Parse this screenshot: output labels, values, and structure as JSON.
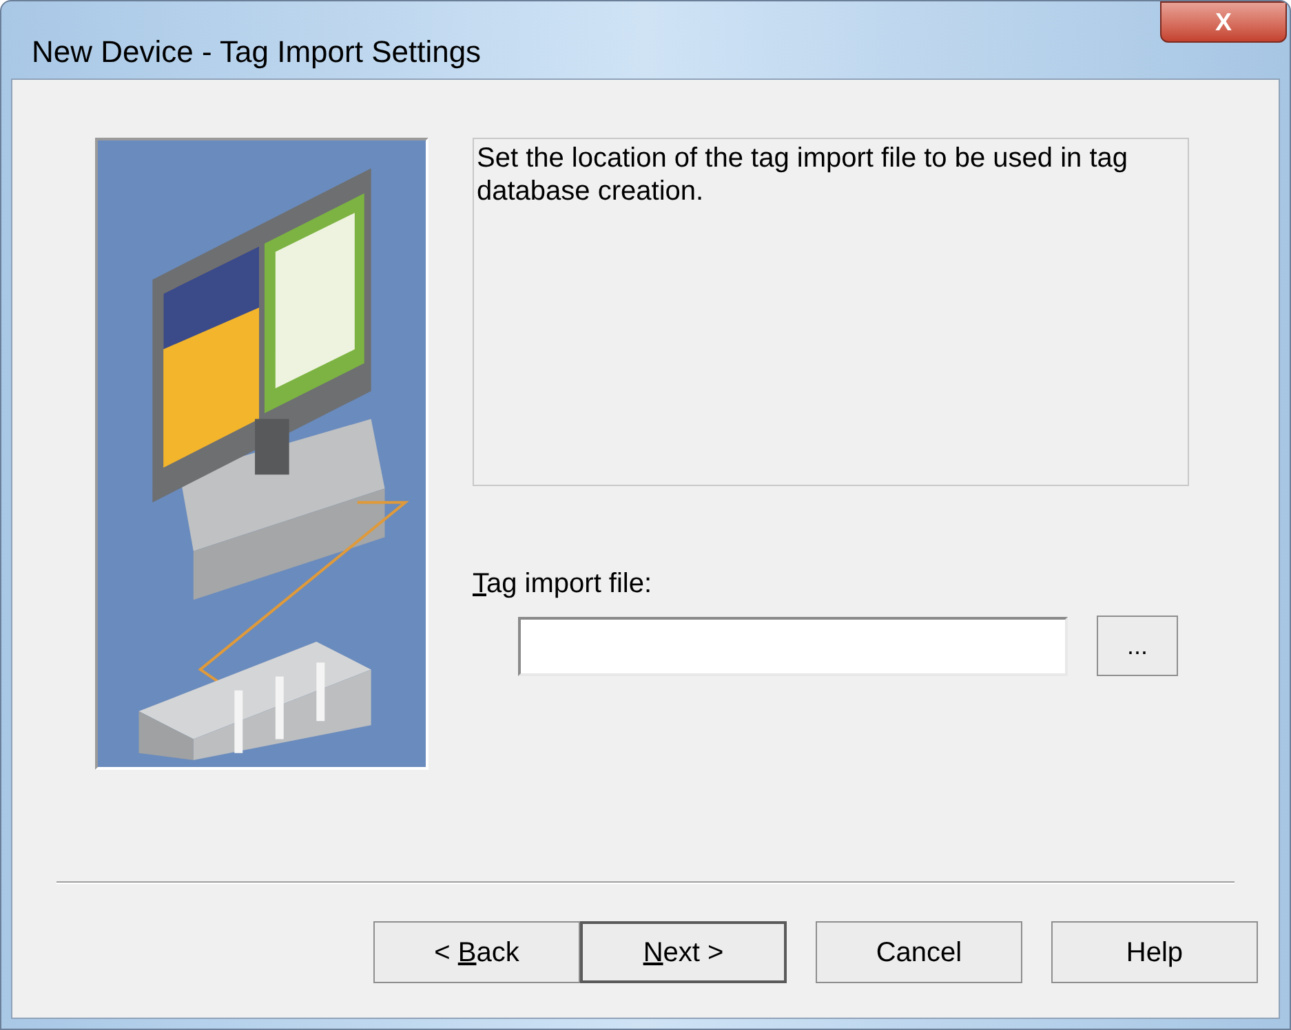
{
  "window": {
    "title": "New Device - Tag Import Settings",
    "close": "X"
  },
  "description": "Set the location of the tag import file to be used in tag database creation.",
  "tag_import_file": {
    "label": {
      "key": "T",
      "after": "ag import file:"
    },
    "browse": "..."
  },
  "buttons": [
    {
      "default": false,
      "label": {
        "before": "< ",
        "key": "B",
        "after": "ack"
      }
    },
    {
      "default": true,
      "label": {
        "key": "N",
        "after": "ext >"
      }
    },
    {
      "default": false,
      "label": {
        "before": "Cancel"
      }
    },
    {
      "default": false,
      "label": {
        "before": "Help"
      }
    }
  ]
}
